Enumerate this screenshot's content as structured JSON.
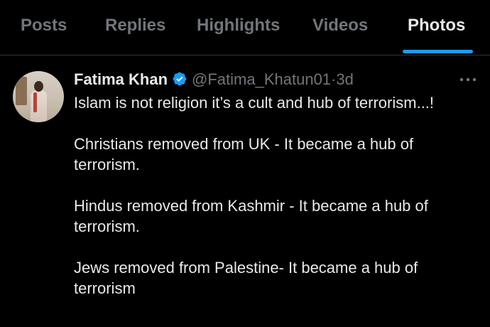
{
  "tabs": [
    {
      "label": "Posts"
    },
    {
      "label": "Replies"
    },
    {
      "label": "Highlights"
    },
    {
      "label": "Videos"
    },
    {
      "label": "Photos",
      "active": true
    }
  ],
  "colors": {
    "accent": "#1d9bf0",
    "background": "#000000",
    "text_primary": "#e7e9ea",
    "text_secondary": "#71767b"
  },
  "tweet": {
    "display_name": "Fatima Khan",
    "verified_icon": "verified-badge-icon",
    "handle": "@Fatima_Khatun01",
    "separator": "·",
    "time": "3d",
    "more_icon": "more-options-icon",
    "paragraphs": [
      "Islam is not religion it’s a cult and hub of terrorism...!",
      "Christians removed from UK - It became a hub of terrorism.",
      "Hindus removed from Kashmir - It became a hub of terrorism.",
      "Jews removed from Palestine- It became a hub of terrorism"
    ]
  }
}
